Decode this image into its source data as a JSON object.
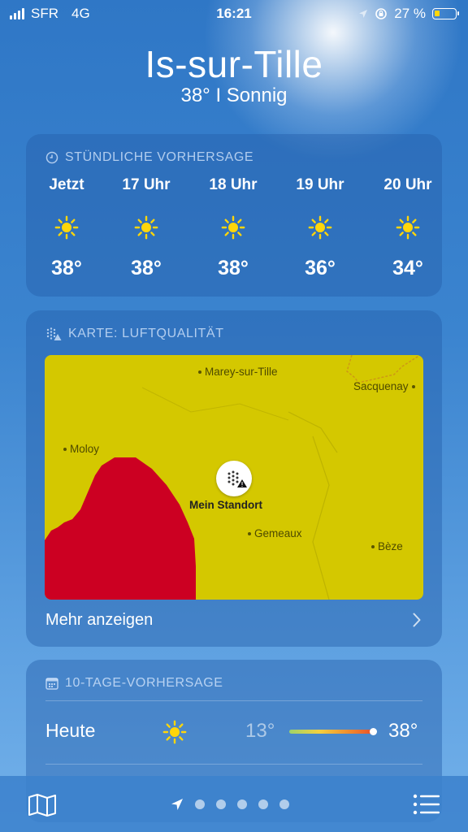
{
  "status_bar": {
    "carrier": "SFR",
    "network": "4G",
    "time": "16:21",
    "battery": "27 %",
    "battery_level": 0.27,
    "icons": [
      "signal-icon",
      "location-arrow-icon",
      "rotation-lock-icon",
      "battery-icon"
    ]
  },
  "header": {
    "city": "Is-sur-Tille",
    "summary": "38°  I  Sonnig"
  },
  "hourly": {
    "title": "STÜNDLICHE VORHERSAGE",
    "icon": "clock-icon",
    "items": [
      {
        "label": "Jetzt",
        "icon": "sun-icon",
        "temp": "38°"
      },
      {
        "label": "17 Uhr",
        "icon": "sun-icon",
        "temp": "38°"
      },
      {
        "label": "18 Uhr",
        "icon": "sun-icon",
        "temp": "38°"
      },
      {
        "label": "19 Uhr",
        "icon": "sun-icon",
        "temp": "36°"
      },
      {
        "label": "20 Uhr",
        "icon": "sun-icon",
        "temp": "34°"
      }
    ]
  },
  "air_quality": {
    "title": "KARTE: LUFTQUALITÄT",
    "icon": "air-quality-icon",
    "places": [
      "Marey-sur-Tille",
      "Sacquenay",
      "Moloy",
      "Gemeaux",
      "Bèze"
    ],
    "location_label": "Mein Standort",
    "more": "Mehr anzeigen",
    "colors": {
      "moderate": "#d4c800",
      "high": "#cc0022"
    }
  },
  "ten_day": {
    "title": "10-TAGE-VORHERSAGE",
    "icon": "calendar-icon",
    "rows": [
      {
        "day": "Heute",
        "icon": "sun-icon",
        "low": "13°",
        "high": "38°"
      }
    ]
  },
  "toolbar": {
    "icons": [
      "map-icon",
      "location-arrow-icon",
      "list-icon"
    ],
    "pages": 5
  }
}
